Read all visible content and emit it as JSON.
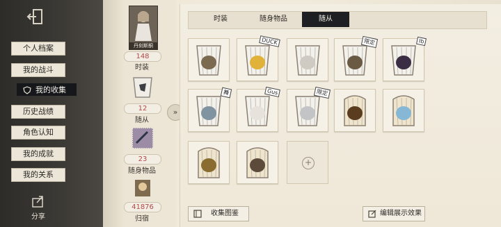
{
  "nav": {
    "items": [
      {
        "label": "个人档案",
        "active": false
      },
      {
        "label": "我的战斗",
        "active": false
      },
      {
        "label": "我的收集",
        "active": true
      },
      {
        "label": "历史战绩",
        "active": false
      },
      {
        "label": "角色认知",
        "active": false
      },
      {
        "label": "我的成就",
        "active": false
      },
      {
        "label": "我的关系",
        "active": false
      }
    ],
    "share_label": "分享",
    "exit_icon": "exit-door-icon",
    "share_icon": "share-icon"
  },
  "summary": {
    "portrait_name": "丹刻斯酮",
    "costume": {
      "count": "148",
      "label": "时装"
    },
    "follower": {
      "count": "12",
      "label": "随从"
    },
    "accessory": {
      "count": "23",
      "label": "随身物品"
    },
    "residence": {
      "count": "41876",
      "label": "归宿"
    }
  },
  "tabs": [
    {
      "label": "时装",
      "active": false
    },
    {
      "label": "随身物品",
      "active": false
    },
    {
      "label": "随从",
      "active": true
    }
  ],
  "grid": {
    "items": [
      {
        "name": "owl-follower",
        "badge": ""
      },
      {
        "name": "duck-follower",
        "badge": "DUCK"
      },
      {
        "name": "zebra-follower",
        "badge": ""
      },
      {
        "name": "monkey-follower",
        "badge": "限定"
      },
      {
        "name": "crow-doll-follower",
        "badge": "Ib"
      },
      {
        "name": "rhino-follower",
        "badge": "舞"
      },
      {
        "name": "skull-follower",
        "badge": "Gus"
      },
      {
        "name": "cat-follower",
        "badge": "限定"
      },
      {
        "name": "bell-follower",
        "badge": ""
      },
      {
        "name": "butterfly-follower",
        "badge": ""
      },
      {
        "name": "gramophone-follower",
        "badge": ""
      },
      {
        "name": "projector-follower",
        "badge": ""
      }
    ],
    "add_slot": true
  },
  "bottom": {
    "collection_label": "收集图鉴",
    "edit_label": "编辑展示效果"
  },
  "colors": {
    "active_bg": "#1d1f22",
    "count_red": "#b24848"
  }
}
